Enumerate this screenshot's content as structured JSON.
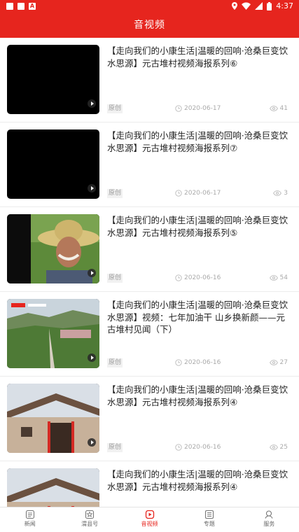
{
  "status_bar": {
    "time": "4:37"
  },
  "app_bar": {
    "title": "音视频"
  },
  "items": [
    {
      "title": "【走向我们的小康生活|温暖的回响·沧桑巨变饮水思源】元古堆村视频海报系列⑥",
      "tag": "原创",
      "date": "2020-06-17",
      "views": "41"
    },
    {
      "title": "【走向我们的小康生活|温暖的回响·沧桑巨变饮水思源】元古堆村视频海报系列⑦",
      "tag": "原创",
      "date": "2020-06-17",
      "views": "3"
    },
    {
      "title": "【走向我们的小康生活|温暖的回响·沧桑巨变饮水思源】元古堆村视频海报系列⑤",
      "tag": "原创",
      "date": "2020-06-16",
      "views": "54"
    },
    {
      "title": "【走向我们的小康生活|温暖的回响·沧桑巨变饮水思源】视频：七年加油干 山乡换新颜——元古堆村见闻（下）",
      "tag": "原创",
      "date": "2020-06-16",
      "views": "27"
    },
    {
      "title": "【走向我们的小康生活|温暖的回响·沧桑巨变饮水思源】元古堆村视频海报系列④",
      "tag": "原创",
      "date": "2020-06-16",
      "views": "25"
    },
    {
      "title": "【走向我们的小康生活|温暖的回响·沧桑巨变饮水思源】元古堆村视频海报系列④",
      "tag": "",
      "date": "",
      "views": ""
    }
  ],
  "tabs": [
    {
      "label": "新闻",
      "icon": "news-icon"
    },
    {
      "label": "渭县号",
      "icon": "county-account-icon"
    },
    {
      "label": "音视频",
      "icon": "video-icon",
      "active": true
    },
    {
      "label": "专题",
      "icon": "topic-icon"
    },
    {
      "label": "服务",
      "icon": "service-icon"
    }
  ],
  "colors": {
    "brand": "#e6251e",
    "meta": "#aaaaaa"
  }
}
